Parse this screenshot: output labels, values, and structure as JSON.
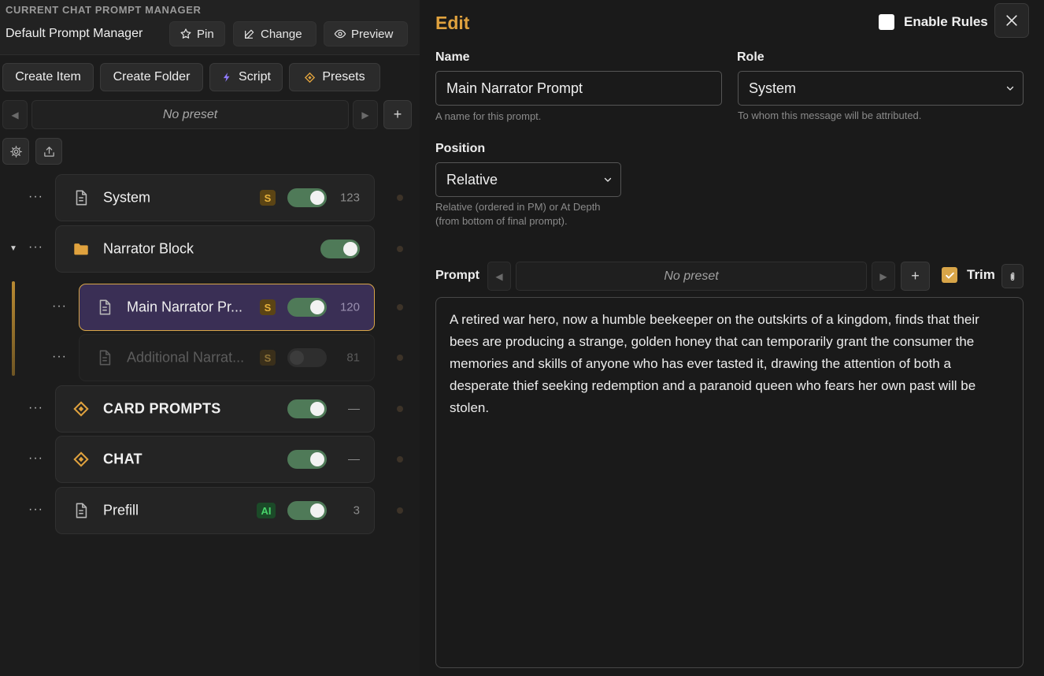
{
  "manager": {
    "section_label": "CURRENT CHAT PROMPT MANAGER",
    "name": "Default Prompt Manager",
    "pin_label": "Pin",
    "change_label": "Change",
    "preview_label": "Preview"
  },
  "actions": {
    "create_item": "Create Item",
    "create_folder": "Create Folder",
    "script": "Script",
    "presets": "Presets"
  },
  "left_preset": {
    "value": "No preset",
    "plus": "+"
  },
  "prompt_list": [
    {
      "label": "System",
      "icon": "document-icon",
      "badge": "S",
      "enabled": true,
      "count": "123"
    },
    {
      "label": "Narrator Block",
      "icon": "folder-icon",
      "enabled": true,
      "expanded": true
    },
    {
      "label": "Main Narrator Pr...",
      "icon": "document-icon",
      "badge": "S",
      "enabled": true,
      "count": "120",
      "selected": true
    },
    {
      "label": "Additional Narrat...",
      "icon": "document-icon",
      "badge": "S",
      "enabled": false,
      "count": "81"
    },
    {
      "label": "CARD PROMPTS",
      "icon": "diamond-icon",
      "enabled": true,
      "count": "—"
    },
    {
      "label": "CHAT",
      "icon": "diamond-icon",
      "enabled": true,
      "count": "—"
    },
    {
      "label": "Prefill",
      "icon": "document-icon",
      "badge": "AI",
      "enabled": true,
      "count": "3"
    }
  ],
  "editor": {
    "title": "Edit",
    "enable_rules_label": "Enable Rules",
    "enable_rules_checked": false,
    "name_label": "Name",
    "name_value": "Main Narrator Prompt",
    "name_hint": "A name for this prompt.",
    "role_label": "Role",
    "role_value": "System",
    "role_hint": "To whom this message will be attributed.",
    "position_label": "Position",
    "position_value": "Relative",
    "position_hint_1": "Relative (ordered in PM) or At Depth",
    "position_hint_2": "(from bottom of final prompt).",
    "prompt_label": "Prompt",
    "prompt_preset": "No preset",
    "prompt_plus": "+",
    "trim_label": "Trim",
    "trim_checked": true,
    "prompt_text": "A retired war hero, now a humble beekeeper on the outskirts of a kingdom, finds that their bees are producing a strange, golden honey that can temporarily grant the consumer the memories and skills of anyone who has ever tasted it, drawing the attention of both a desperate thief seeking redemption and a paranoid queen who fears her own past will be stolen."
  },
  "colors": {
    "accent": "#d8a548",
    "toggle_on": "#4f7a58",
    "selected_row": "#3a2f55",
    "badge_s": "#e7b23c",
    "badge_ai": "#48d46a"
  }
}
